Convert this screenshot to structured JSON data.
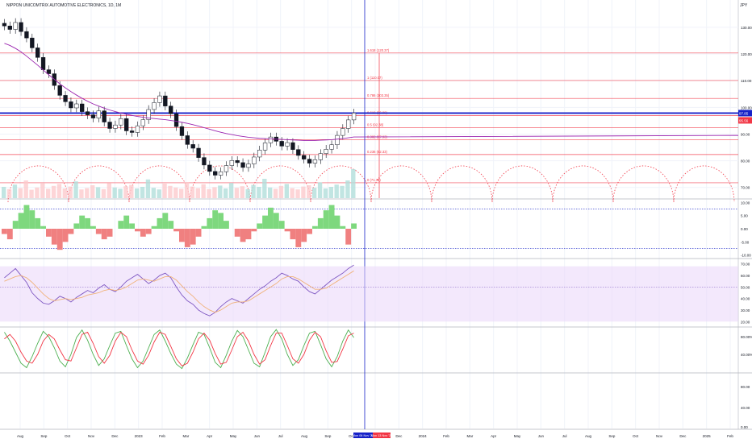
{
  "title": "NIPPON UNICOMTRIX AUTOMOTIVE ELECTRONICS, 1D, 1M",
  "currency": "JPY",
  "colors": {
    "grid": "#f0f3fa",
    "fib": "#f23645",
    "blue": "#1722c8",
    "ma": "#9c27b0",
    "up": "#26a69a",
    "down": "#ef5350",
    "osc_up": "#7ed87e",
    "osc_down": "#f08080",
    "rsi": "#7e57c2",
    "rsi_band": "#e9d5f9",
    "stoch_k": "#4caf50",
    "stoch_d": "#f23645"
  },
  "chart_data": [
    {
      "type": "line",
      "panel": "price",
      "title": "",
      "x_tick_labels": [
        "Aug",
        "Sep",
        "Oct",
        "Nov",
        "Dec",
        "2023",
        "Feb",
        "Mar",
        "Apr",
        "May",
        "Jun",
        "Jul",
        "Aug",
        "Sep",
        "Oct",
        "Nov",
        "Dec",
        "2024",
        "Feb",
        "Mar",
        "Apr",
        "May",
        "Jun",
        "Jul",
        "Aug",
        "Sep",
        "Oct",
        "Nov",
        "Dec",
        "2025",
        "Feb"
      ],
      "y_ticks": [
        70,
        80,
        90,
        100,
        110,
        120,
        130
      ],
      "y_tick_labels": [
        "70.00",
        "80.00",
        "90.00",
        "100.00",
        "110.00",
        "120.00",
        "130.00"
      ],
      "ylim": [
        66,
        136
      ],
      "current_price_label": "97.85",
      "secondary_price_label": "95.56",
      "horizontal_line_value": 97.85,
      "fib_levels": [
        {
          "label": "1.618 (120.37)",
          "value": 120.37
        },
        {
          "label": "1 (110.07)",
          "value": 110.07
        },
        {
          "label": "0.786 (103.35)",
          "value": 103.35
        },
        {
          "label": "0.618 (96.89)",
          "value": 96.89
        },
        {
          "label": "0.5 (92.38)",
          "value": 92.38
        },
        {
          "label": "0.382 (87.93)",
          "value": 87.93
        },
        {
          "label": "0.236 (82.33)",
          "value": 82.33
        },
        {
          "label": "0 (71.75)",
          "value": 71.75
        }
      ],
      "series": [
        {
          "values": [
            130.5,
            129.2,
            131.8,
            128.4,
            126.0,
            122.3,
            118.7,
            114.1,
            112.6,
            108.2,
            104.5,
            102.1,
            99.8,
            101.3,
            98.4,
            97.2,
            96.0,
            98.7,
            94.5,
            92.1,
            93.4,
            95.8,
            91.2,
            90.6,
            93.1,
            95.4,
            99.2,
            101.8,
            104.3,
            100.5,
            97.6,
            92.8,
            89.4,
            86.1,
            84.7,
            81.2,
            78.4,
            76.0,
            74.6,
            75.9,
            78.2,
            80.1,
            79.3,
            77.5,
            78.8,
            81.4,
            84.0,
            86.7,
            88.9,
            87.3,
            85.5,
            86.8,
            84.2,
            82.0,
            80.6,
            79.1,
            80.4,
            82.7,
            84.3,
            86.0,
            89.5,
            92.1,
            95.3,
            97.9
          ]
        },
        {
          "values": [
            124.0,
            123.2,
            122.1,
            120.8,
            119.2,
            117.5,
            115.8,
            114.0,
            112.2,
            110.5,
            108.8,
            107.3,
            105.9,
            104.6,
            103.4,
            102.3,
            101.3,
            100.5,
            99.7,
            99.0,
            98.4,
            97.9,
            97.4,
            97.0,
            96.6,
            96.3,
            96.0,
            95.8,
            95.6,
            95.4,
            95.1,
            94.8,
            94.4,
            94.0,
            93.5,
            93.0,
            92.4,
            91.8,
            91.2,
            90.7,
            90.2,
            89.8,
            89.4,
            89.1,
            88.8,
            88.6,
            88.4,
            88.3,
            88.2,
            88.1,
            88.0,
            87.9,
            87.8,
            87.7,
            87.6,
            87.6,
            87.6,
            87.7,
            87.8,
            87.9,
            88.1,
            88.3,
            88.6,
            88.9
          ]
        }
      ],
      "volume": [
        0.35,
        0.28,
        0.42,
        0.31,
        0.55,
        0.26,
        0.33,
        0.47,
        0.29,
        0.38,
        0.44,
        0.3,
        0.36,
        0.52,
        0.27,
        0.31,
        0.4,
        0.34,
        0.28,
        0.46,
        0.33,
        0.29,
        0.37,
        0.41,
        0.3,
        0.35,
        0.58,
        0.32,
        0.27,
        0.45,
        0.38,
        0.33,
        0.29,
        0.5,
        0.36,
        0.31,
        0.43,
        0.28,
        0.34,
        0.39,
        0.3,
        0.47,
        0.32,
        0.37,
        0.28,
        0.41,
        0.35,
        0.6,
        0.33,
        0.29,
        0.38,
        0.44,
        0.31,
        0.27,
        0.36,
        0.4,
        0.32,
        0.49,
        0.3,
        0.35,
        0.42,
        0.38,
        0.55,
        0.9
      ]
    },
    {
      "type": "bar",
      "panel": "oscillator",
      "y_tick_labels": [
        "10.00",
        "5.00",
        "0.00",
        "-5.00",
        "-10.00"
      ],
      "y_ticks": [
        10,
        5,
        0,
        -5,
        -10
      ],
      "ylim": [
        -11,
        11
      ],
      "upper_band": 7.5,
      "lower_band": -7.5,
      "values": [
        -2,
        -4,
        3,
        6,
        9,
        7,
        4,
        1,
        -3,
        -6,
        -8,
        -5,
        -2,
        2,
        5,
        4,
        1,
        -2,
        -4,
        -3,
        0,
        3,
        5,
        2,
        -1,
        -3,
        -2,
        1,
        4,
        6,
        3,
        -1,
        -5,
        -7,
        -6,
        -3,
        1,
        4,
        7,
        6,
        3,
        0,
        -3,
        -5,
        -4,
        -1,
        2,
        5,
        8,
        6,
        3,
        -1,
        -4,
        -7,
        -5,
        -2,
        1,
        4,
        7,
        9,
        5,
        1,
        -6,
        2
      ]
    },
    {
      "type": "line",
      "panel": "rsi",
      "y_tick_labels": [
        "70.00",
        "60.00",
        "50.00",
        "40.00",
        "30.00",
        "20.00"
      ],
      "y_ticks": [
        70,
        60,
        50,
        40,
        30,
        20
      ],
      "ylim": [
        16,
        74
      ],
      "band": [
        20,
        68
      ],
      "midline": 50,
      "series": [
        {
          "values": [
            58,
            62,
            66,
            60,
            54,
            45,
            40,
            36,
            35,
            38,
            42,
            40,
            37,
            41,
            44,
            47,
            45,
            49,
            52,
            48,
            46,
            50,
            55,
            58,
            61,
            57,
            53,
            56,
            60,
            62,
            58,
            50,
            43,
            38,
            35,
            30,
            27,
            25,
            28,
            33,
            37,
            40,
            38,
            36,
            40,
            44,
            48,
            51,
            55,
            58,
            62,
            60,
            57,
            55,
            50,
            46,
            44,
            48,
            52,
            56,
            59,
            62,
            66,
            69
          ]
        },
        {
          "values": [
            55,
            57,
            59,
            60,
            58,
            54,
            49,
            44,
            40,
            38,
            39,
            40,
            39,
            40,
            41,
            43,
            44,
            45,
            47,
            48,
            47,
            48,
            50,
            53,
            56,
            57,
            56,
            55,
            57,
            59,
            59,
            56,
            51,
            46,
            42,
            37,
            33,
            30,
            28,
            30,
            33,
            36,
            37,
            37,
            38,
            41,
            44,
            47,
            50,
            53,
            57,
            59,
            59,
            57,
            54,
            51,
            48,
            48,
            49,
            52,
            55,
            58,
            61,
            64
          ]
        }
      ]
    },
    {
      "type": "line",
      "panel": "stochastic",
      "y_tick_labels": [
        "80.00%",
        "40.00%"
      ],
      "y_ticks": [
        80,
        40
      ],
      "ylim": [
        0,
        100
      ],
      "series": [
        {
          "values": [
            90,
            70,
            45,
            20,
            10,
            35,
            65,
            92,
            80,
            55,
            25,
            12,
            40,
            78,
            95,
            72,
            40,
            15,
            30,
            60,
            88,
            92,
            60,
            30,
            10,
            25,
            55,
            85,
            95,
            70,
            42,
            18,
            8,
            32,
            62,
            90,
            85,
            55,
            22,
            10,
            38,
            70,
            94,
            80,
            50,
            20,
            12,
            45,
            80,
            96,
            75,
            40,
            15,
            28,
            60,
            88,
            92,
            62,
            30,
            12,
            35,
            70,
            95,
            78
          ]
        },
        {
          "values": [
            75,
            85,
            70,
            45,
            25,
            20,
            40,
            70,
            85,
            75,
            50,
            28,
            25,
            55,
            85,
            90,
            65,
            35,
            20,
            38,
            70,
            90,
            80,
            50,
            25,
            18,
            38,
            68,
            90,
            85,
            58,
            30,
            14,
            20,
            45,
            75,
            88,
            72,
            42,
            18,
            22,
            50,
            80,
            90,
            70,
            40,
            18,
            28,
            60,
            88,
            88,
            60,
            30,
            20,
            40,
            72,
            90,
            80,
            48,
            22,
            24,
            52,
            82,
            88
          ]
        }
      ]
    }
  ],
  "date_labels": {
    "current_date": "Mon 06 Nov '23",
    "secondary_date": "Mon 13 Nov '23"
  },
  "lower_panel": {
    "y_tick_labels": [
      "80.00",
      "40.00",
      "0.00"
    ]
  }
}
